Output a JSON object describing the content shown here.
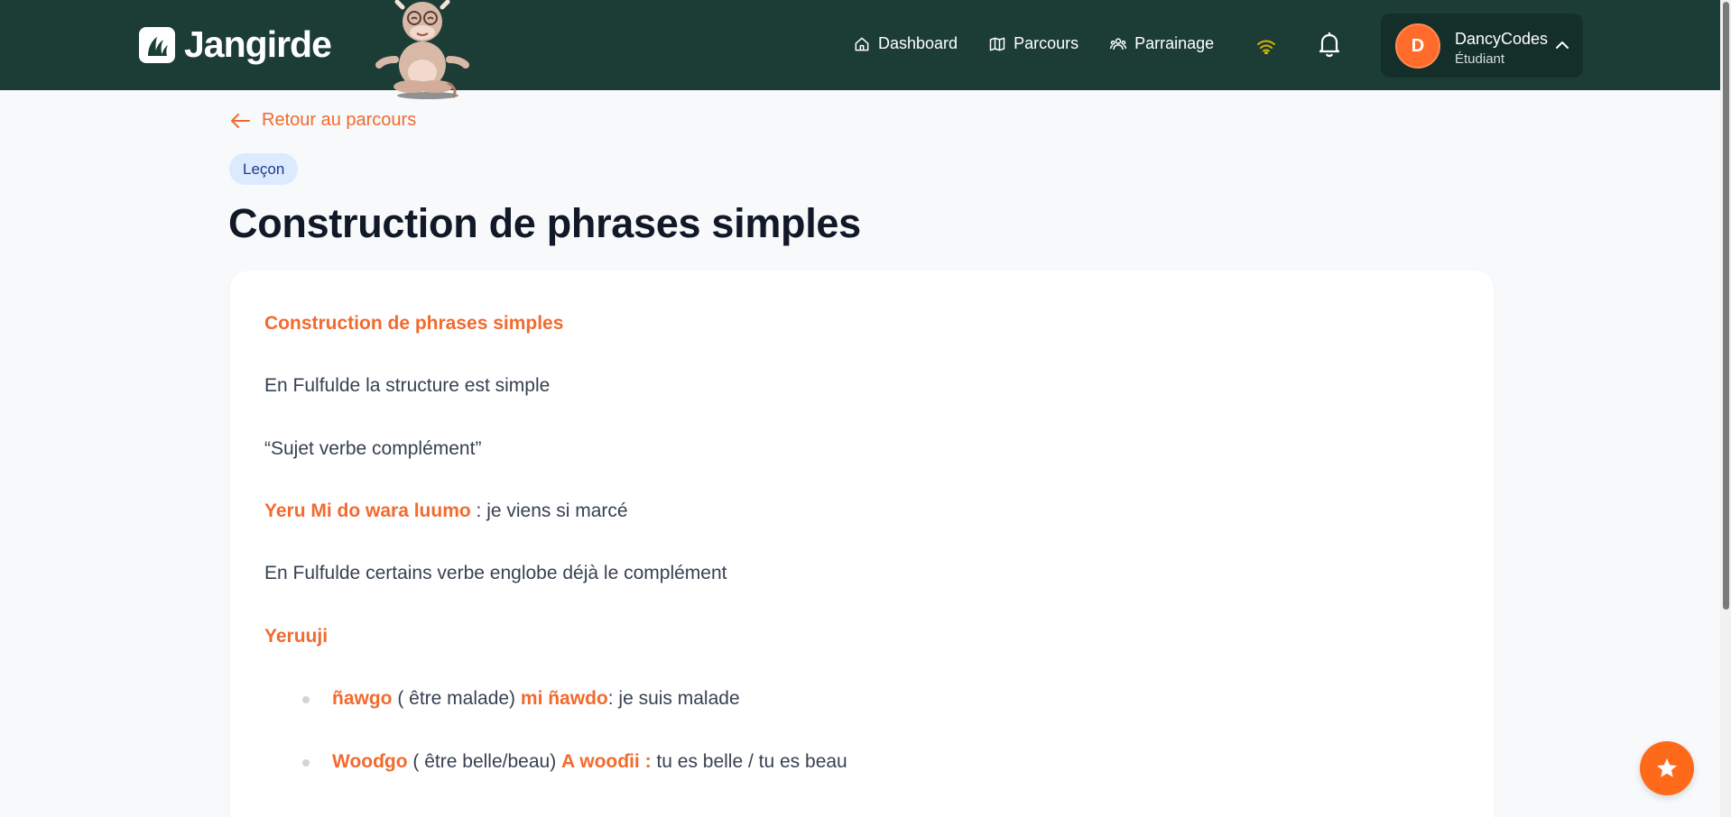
{
  "header": {
    "brand": "Jangirde",
    "nav": [
      {
        "label": "Dashboard",
        "icon": "home-icon"
      },
      {
        "label": "Parcours",
        "icon": "map-icon"
      },
      {
        "label": "Parrainage",
        "icon": "users-icon"
      }
    ],
    "user": {
      "initial": "D",
      "name": "DancyCodes",
      "role": "Étudiant"
    }
  },
  "content": {
    "back_link": "Retour au parcours",
    "badge": "Leçon",
    "title": "Construction de phrases simples",
    "lesson": {
      "heading": "Construction de phrases simples",
      "p1": "En Fulfulde la structure est simple",
      "p2": "“Sujet verbe complément”",
      "example1": {
        "term": "Yeru Mi do wara luumo",
        "rest": " : je viens si marcé"
      },
      "p3": "En Fulfulde certains verbe englobe déjà le complément",
      "subheading": "Yeruuji",
      "bullets": [
        {
          "term1": "ñawgo",
          "mid": " ( être malade) ",
          "term2": "mi ñawdo",
          "rest": ": je suis malade"
        },
        {
          "term1": "Wooɗgo",
          "mid": " ( être belle/beau) ",
          "term2": "A wooɗii :",
          "rest": " tu es belle / tu es beau"
        }
      ]
    }
  },
  "colors": {
    "header_bg": "#1c3d36",
    "accent": "#f26a2e",
    "fab": "#ff6a1a"
  }
}
